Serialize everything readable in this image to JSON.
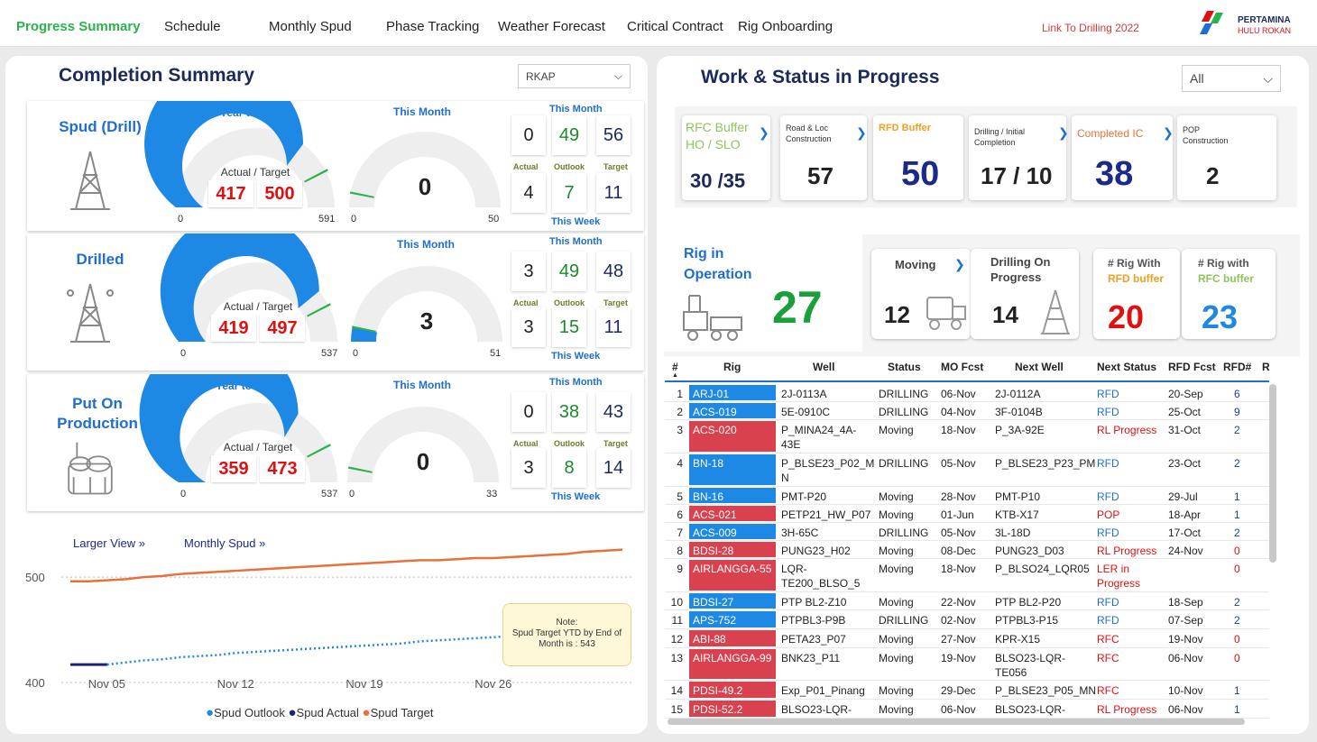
{
  "nav": {
    "tabs": [
      "Progress Summary",
      "Schedule",
      "Monthly Spud",
      "Phase Tracking",
      "Weather Forecast",
      "Critical Contract",
      "Rig Onboarding"
    ],
    "link": "Link To Drilling 2022",
    "logo_line1": "PERTAMINA",
    "logo_line2": "HULU ROKAN"
  },
  "completion": {
    "title": "Completion Summary",
    "dropdown": "RKAP",
    "sections": [
      {
        "name": "Spud (Drill)",
        "ytd_label": "Year to Date",
        "month_label": "This Month",
        "ytd_caption": "Actual / Target",
        "ytd_actual": "417",
        "ytd_target": "500",
        "ytd_min": "0",
        "ytd_max": "591",
        "ytd_fraction": 0.706,
        "month_value": "0",
        "month_min": "0",
        "month_max": "50",
        "month_fraction": 0,
        "tm_label": "This Month",
        "tw_label": "This Week",
        "sub": [
          "Actual",
          "Outlook",
          "Target"
        ],
        "month_vals": [
          "0",
          "49",
          "56"
        ],
        "week_vals": [
          "4",
          "7",
          "11"
        ]
      },
      {
        "name": "Drilled",
        "ytd_label": "Year to Date",
        "month_label": "This Month",
        "ytd_caption": "Actual / Target",
        "ytd_actual": "419",
        "ytd_target": "497",
        "ytd_min": "0",
        "ytd_max": "537",
        "ytd_fraction": 0.78,
        "month_value": "3",
        "month_min": "0",
        "month_max": "51",
        "month_fraction": 0.059,
        "tm_label": "This Month",
        "tw_label": "This Week",
        "sub": [
          "Actual",
          "Outlook",
          "Target"
        ],
        "month_vals": [
          "3",
          "49",
          "48"
        ],
        "week_vals": [
          "3",
          "15",
          "11"
        ]
      },
      {
        "name": "Put On Production",
        "ytd_label": "Year to Date",
        "month_label": "This Month",
        "ytd_caption": "Actual / Target",
        "ytd_actual": "359",
        "ytd_target": "473",
        "ytd_min": "0",
        "ytd_max": "537",
        "ytd_fraction": 0.669,
        "month_value": "0",
        "month_min": "0",
        "month_max": "33",
        "month_fraction": 0,
        "tm_label": "This Month",
        "tw_label": "This Week",
        "sub": [
          "Actual",
          "Outlook",
          "Target"
        ],
        "month_vals": [
          "0",
          "38",
          "43"
        ],
        "week_vals": [
          "3",
          "8",
          "14"
        ]
      }
    ]
  },
  "spud_chart": {
    "larger_view": "Larger View »",
    "monthly_spud": "Monthly Spud »",
    "note_title": "Note:",
    "note_text": "Spud Target YTD by End of Month is : 543",
    "legend": [
      "Spud Outlook",
      "Spud Actual",
      "Spud Target"
    ],
    "colors": {
      "outlook": "#1e88e5",
      "actual": "#1a237e",
      "target": "#e8703a"
    }
  },
  "chart_data": {
    "type": "line",
    "x_ticks": [
      "Nov 05",
      "Nov 12",
      "Nov 19",
      "Nov 26"
    ],
    "y_ticks": [
      "400",
      "500"
    ],
    "ylim": [
      400,
      530
    ],
    "series": [
      {
        "name": "Spud Target",
        "values": [
          496,
          496,
          497,
          498,
          500,
          501,
          503,
          504,
          505,
          506,
          507,
          508,
          509,
          510,
          511,
          512,
          513,
          514,
          515,
          516,
          516,
          517,
          518,
          518,
          519,
          520,
          521,
          522,
          524,
          525,
          526
        ]
      },
      {
        "name": "Spud Actual",
        "values": [
          417,
          417,
          417
        ]
      },
      {
        "name": "Spud Outlook",
        "values": [
          null,
          null,
          417,
          419,
          421,
          422,
          424,
          425,
          426,
          428,
          429,
          430,
          431,
          432,
          433,
          434,
          435,
          436,
          437,
          439,
          440,
          441,
          442,
          443,
          444,
          445,
          446,
          447,
          448,
          450,
          452
        ]
      }
    ]
  },
  "work": {
    "title": "Work & Status in Progress",
    "dropdown": "All",
    "cards": [
      {
        "title": "RFC Buffer HO / SLO",
        "value": "30 /35"
      },
      {
        "title": "Road & Loc Construction",
        "value": "57"
      },
      {
        "title": "RFD Buffer",
        "value": "50"
      },
      {
        "title": "Drilling / Initial Completion",
        "value": "17 / 10"
      },
      {
        "title": "Completed IC",
        "value": "38"
      },
      {
        "title": "POP Construction",
        "value": "2"
      }
    ],
    "rig_op_label": "Rig in Operation",
    "rig_op_value": "27",
    "moving_label": "Moving",
    "moving_value": "12",
    "drilling_label": "Drilling On Progress",
    "drilling_value": "14",
    "rfd_rig_label1": "# Rig With",
    "rfd_rig_label2": "RFD buffer",
    "rfd_rig_value": "20",
    "rfc_rig_label1": "# Rig with",
    "rfc_rig_label2": "RFC buffer",
    "rfc_rig_value": "23"
  },
  "table": {
    "headers": [
      "#",
      "Rig",
      "Well",
      "Status",
      "MO Fcst",
      "Next Well",
      "Next Status",
      "RFD Fcst",
      "RFD#",
      "R"
    ],
    "rows": [
      {
        "n": "1",
        "rig": "ARJ-01",
        "c": "#1e88e5",
        "well": "2J-0113A",
        "status": "DRILLING",
        "mo": "06-Nov",
        "next": "2J-0112A",
        "ns": "RFD",
        "nsc": "#1e6fd0",
        "rfd": "20-Sep",
        "num": "6",
        "numc": "#1e3a9a",
        "h": 20
      },
      {
        "n": "2",
        "rig": "ACS-019",
        "c": "#1e88e5",
        "well": "5E-0910C",
        "status": "DRILLING",
        "mo": "04-Nov",
        "next": "3F-0104B",
        "ns": "RFD",
        "nsc": "#1e6fd0",
        "rfd": "25-Oct",
        "num": "9",
        "numc": "#1e3a9a",
        "h": 20
      },
      {
        "n": "3",
        "rig": "ACS-020",
        "c": "#d9414f",
        "well": "P_MINA24_4A-\n43E",
        "status": "Moving",
        "mo": "18-Nov",
        "next": "P_3A-92E",
        "ns": "RL Progress",
        "nsc": "#e01010",
        "rfd": "31-Oct",
        "num": "2",
        "numc": "#1e3a9a",
        "h": 37
      },
      {
        "n": "4",
        "rig": "BN-18",
        "c": "#1e88e5",
        "well": "P_BLSE23_P02_M\nN",
        "status": "DRILLING",
        "mo": "05-Nov",
        "next": "P_BLSE23_P23_PM",
        "ns": "RFD",
        "nsc": "#1e6fd0",
        "rfd": "23-Oct",
        "num": "2",
        "numc": "#1e3a9a",
        "h": 37
      },
      {
        "n": "5",
        "rig": "BN-16",
        "c": "#1e88e5",
        "well": "PMT-P20",
        "status": "Moving",
        "mo": "28-Nov",
        "next": "PMT-P10",
        "ns": "RFD",
        "nsc": "#1e6fd0",
        "rfd": "29-Jul",
        "num": "1",
        "numc": "#1e3a9a",
        "h": 20
      },
      {
        "n": "6",
        "rig": "ACS-021",
        "c": "#d9414f",
        "well": "PETP21_HW_P07",
        "status": "Moving",
        "mo": "01-Jun",
        "next": "KTB-X17",
        "ns": "POP",
        "nsc": "#e01010",
        "rfd": "18-Apr",
        "num": "1",
        "numc": "#1e3a9a",
        "h": 20
      },
      {
        "n": "7",
        "rig": "ACS-009",
        "c": "#1e88e5",
        "well": "3H-65C",
        "status": "DRILLING",
        "mo": "05-Nov",
        "next": "3L-18D",
        "ns": "RFD",
        "nsc": "#1e6fd0",
        "rfd": "17-Oct",
        "num": "2",
        "numc": "#1e3a9a",
        "h": 20
      },
      {
        "n": "8",
        "rig": "BDSI-28",
        "c": "#d9414f",
        "well": "PUNG23_H02",
        "status": "Moving",
        "mo": "08-Dec",
        "next": "PUNG23_D03",
        "ns": "RL Progress",
        "nsc": "#e01010",
        "rfd": "24-Nov",
        "num": "0",
        "numc": "#e01010",
        "h": 20
      },
      {
        "n": "9",
        "rig": "AIRLANGGA-55",
        "c": "#d9414f",
        "well": "LQR-\nTE200_BLSO_5",
        "status": "Moving",
        "mo": "18-Nov",
        "next": "P_BLSO24_LQR05",
        "ns": "LER in\nProgress",
        "nsc": "#e01010",
        "rfd": "",
        "num": "0",
        "numc": "#e01010",
        "h": 37
      },
      {
        "n": "10",
        "rig": "BDSI-27",
        "c": "#1e88e5",
        "well": "PTP BL2-Z10",
        "status": "Moving",
        "mo": "22-Nov",
        "next": "PTP BL2-P20",
        "ns": "RFD",
        "nsc": "#1e6fd0",
        "rfd": "18-Sep",
        "num": "2",
        "numc": "#1e3a9a",
        "h": 20
      },
      {
        "n": "11",
        "rig": "APS-752",
        "c": "#1e88e5",
        "well": "PTPBL3-P9B",
        "status": "DRILLING",
        "mo": "02-Nov",
        "next": "PTPBL3-P15",
        "ns": "RFD",
        "nsc": "#1e6fd0",
        "rfd": "07-Sep",
        "num": "2",
        "numc": "#1e3a9a",
        "h": 21
      },
      {
        "n": "12",
        "rig": "ABI-88",
        "c": "#d9414f",
        "well": "PETA23_P07",
        "status": "Moving",
        "mo": "27-Nov",
        "next": "KPR-X15",
        "ns": "RFC",
        "nsc": "#e01010",
        "rfd": "19-Nov",
        "num": "0",
        "numc": "#e01010",
        "h": 21
      },
      {
        "n": "13",
        "rig": "AIRLANGGA-99",
        "c": "#d9414f",
        "well": "BNK23_P11",
        "status": "Moving",
        "mo": "19-Nov",
        "next": "BLSO23-LQR-\nTE056",
        "ns": "RFC",
        "nsc": "#e01010",
        "rfd": "06-Nov",
        "num": "0",
        "numc": "#e01010",
        "h": 36
      },
      {
        "n": "14",
        "rig": "PDSI-49.2",
        "c": "#d9414f",
        "well": "Exp_P01_Pinang",
        "status": "Moving",
        "mo": "29-Dec",
        "next": "P_BLSE23_P05_MN",
        "ns": "RFC",
        "nsc": "#e01010",
        "rfd": "10-Nov",
        "num": "1",
        "numc": "#1e3a9a",
        "h": 21
      },
      {
        "n": "15",
        "rig": "PDSI-52.2",
        "c": "#d9414f",
        "well": "BLSO23-LQR-",
        "status": "Moving",
        "mo": "06-Nov",
        "next": "BLSO23-LQR-",
        "ns": "RL Progress",
        "nsc": "#e01010",
        "rfd": "06-Nov",
        "num": "1",
        "numc": "#1e3a9a",
        "h": 21
      }
    ]
  }
}
